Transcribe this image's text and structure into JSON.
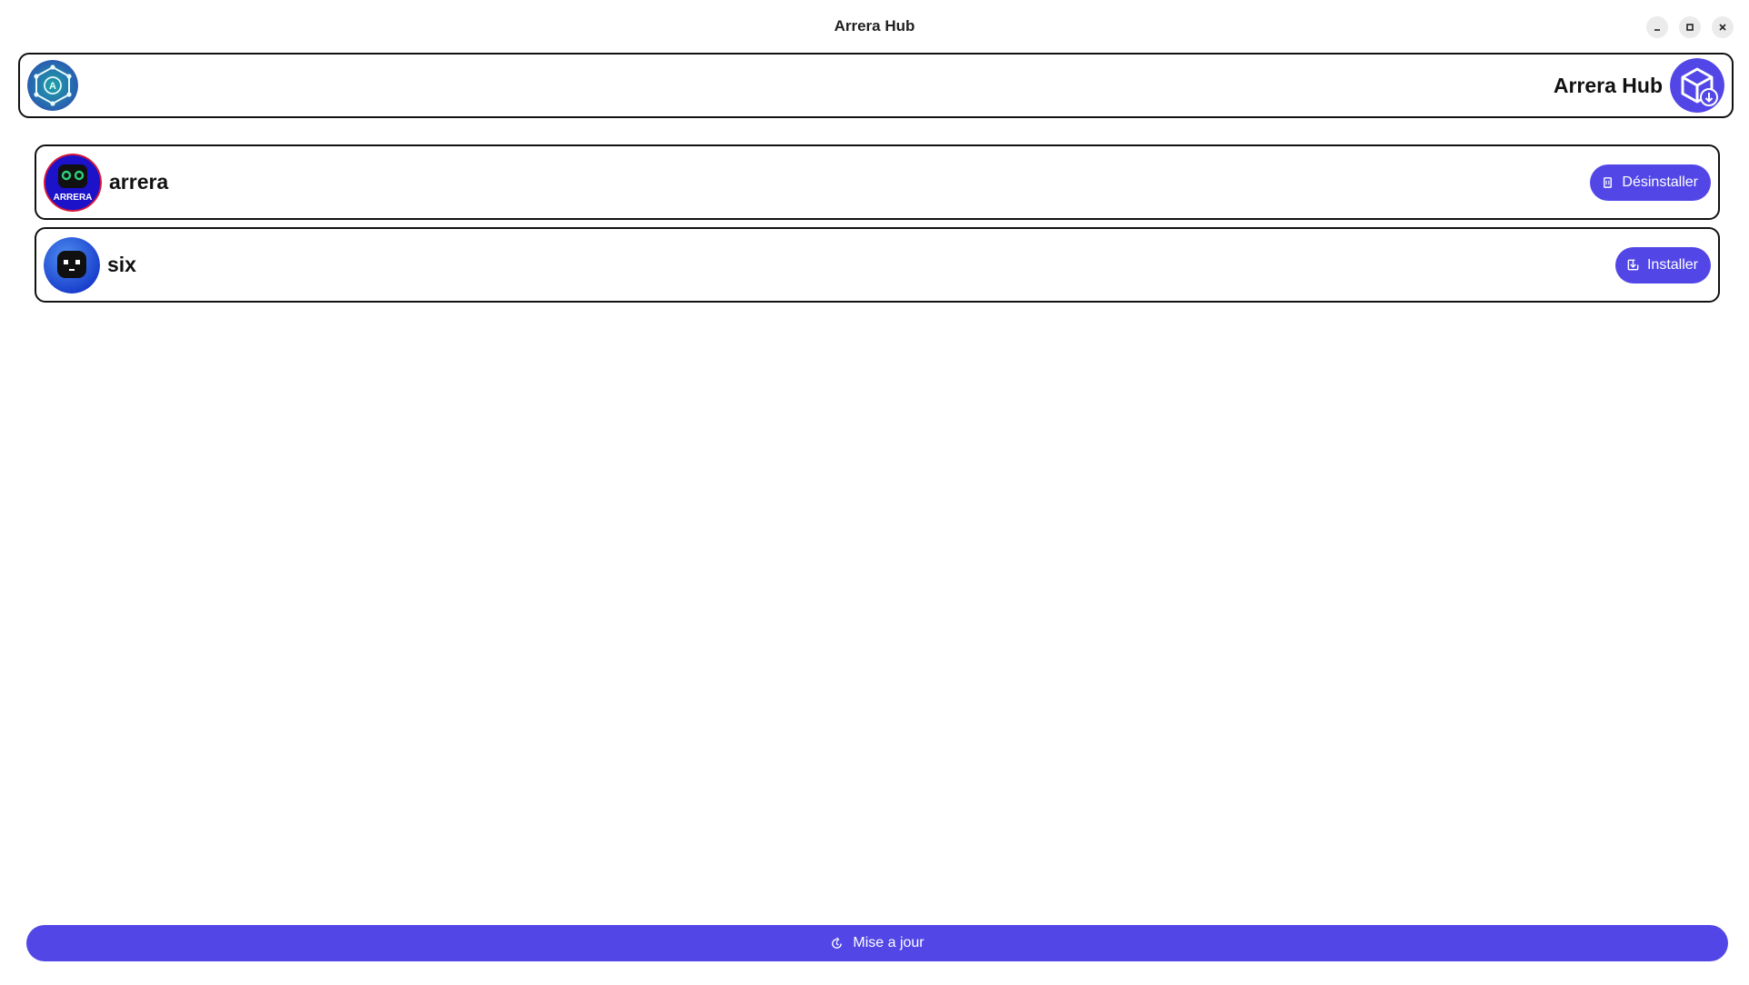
{
  "window": {
    "title": "Arrera Hub"
  },
  "header": {
    "title": "Arrera Hub",
    "left_logo_icon": "atom-network-logo-icon",
    "right_logo_icon": "package-download-icon"
  },
  "apps": [
    {
      "name": "arrera",
      "icon": "arrera-robot-icon",
      "icon_text": "ARRERA",
      "action_label": "Désinstaller",
      "action_icon": "trash-icon"
    },
    {
      "name": "six",
      "icon": "six-robot-icon",
      "action_label": "Installer",
      "action_icon": "install-icon"
    }
  ],
  "footer": {
    "update_label": "Mise a jour",
    "update_icon": "refresh-icon"
  },
  "colors": {
    "accent": "#5247e6",
    "border": "#111111",
    "background": "#ffffff"
  }
}
